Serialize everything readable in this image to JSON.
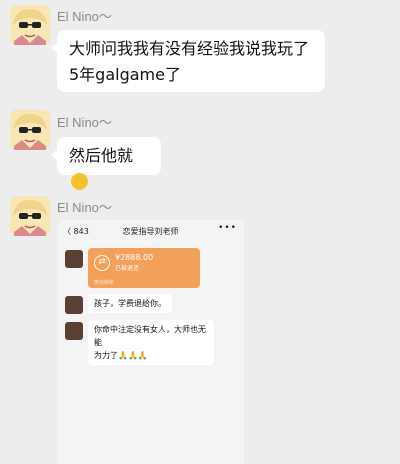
{
  "sender_name": "El Nino～",
  "messages": [
    {
      "text_line1": "大师问我我有没有经验我说我玩了",
      "text_line2": "5年galgame了"
    },
    {
      "text": "然后他就",
      "emoji": "crying-laughing-emoji"
    },
    {
      "type": "image"
    }
  ],
  "shot": {
    "back_label": "〈 843",
    "title": "恋爱指导刘老师",
    "more": "•••",
    "transfer_amount": "¥2888.00",
    "transfer_status": "已被退还",
    "transfer_footer": "微信转账",
    "msg1": "孩子，学费退给你。",
    "msg2_line1": "你命中注定没有女人，大师也无能",
    "msg2_line2": "为力了🙏🙏🙏"
  },
  "colors": {
    "background": "#ededed",
    "bubble": "#ffffff",
    "transfer": "#f3a05a"
  }
}
